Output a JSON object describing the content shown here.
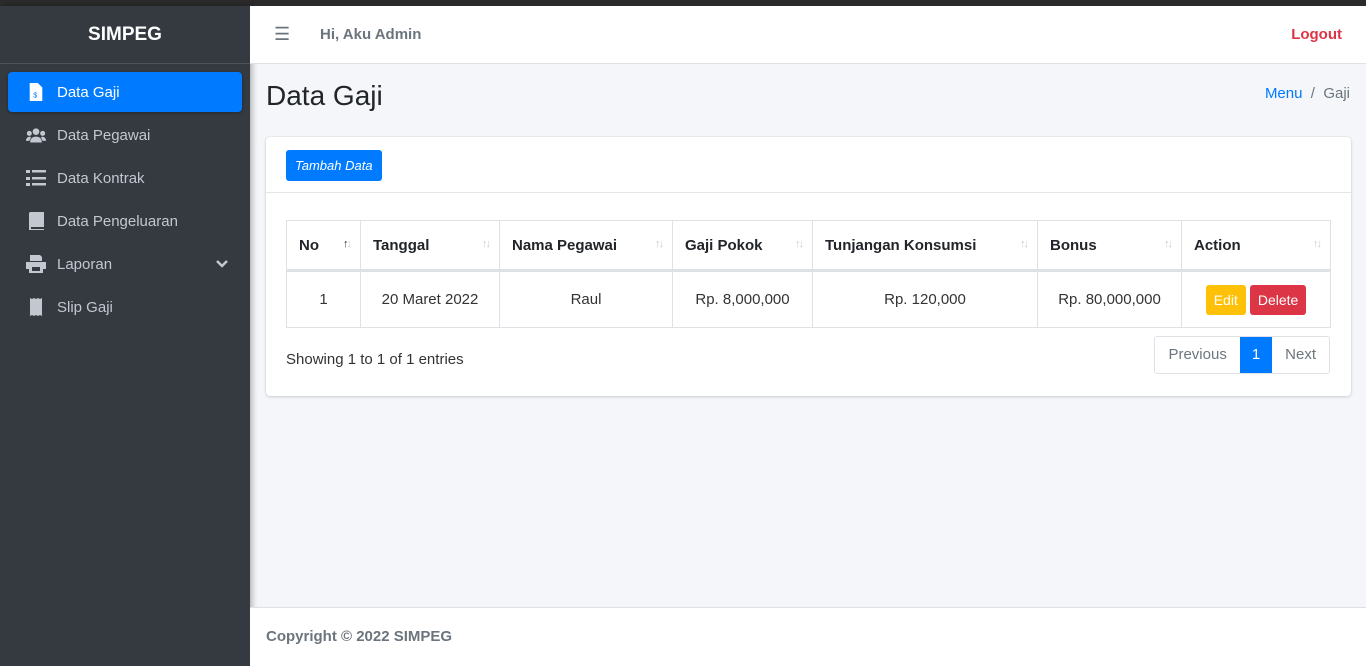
{
  "sidebar": {
    "brand": "SIMPEG",
    "items": [
      {
        "label": "Data Gaji",
        "icon": "file-invoice-dollar-icon",
        "active": true
      },
      {
        "label": "Data Pegawai",
        "icon": "users-icon"
      },
      {
        "label": "Data Kontrak",
        "icon": "tasks-icon"
      },
      {
        "label": "Data Pengeluaran",
        "icon": "book-icon"
      },
      {
        "label": "Laporan",
        "icon": "print-icon",
        "has_submenu": true
      },
      {
        "label": "Slip Gaji",
        "icon": "receipt-icon"
      }
    ]
  },
  "header": {
    "greeting": "Hi, Aku Admin",
    "logout": "Logout"
  },
  "page": {
    "title": "Data Gaji",
    "breadcrumb": [
      "Menu",
      "Gaji"
    ]
  },
  "card": {
    "add_button": "Tambah Data"
  },
  "table": {
    "columns": [
      "No",
      "Tanggal",
      "Nama Pegawai",
      "Gaji Pokok",
      "Tunjangan Konsumsi",
      "Bonus",
      "Action"
    ],
    "rows": [
      {
        "no": "1",
        "tanggal": "20 Maret 2022",
        "nama": "Raul",
        "gaji": "Rp. 8,000,000",
        "tunjangan": "Rp. 120,000",
        "bonus": "Rp. 80,000,000"
      }
    ],
    "edit": "Edit",
    "delete": "Delete"
  },
  "pagination": {
    "info": "Showing 1 to 1 of 1 entries",
    "previous": "Previous",
    "current": "1",
    "next": "Next"
  },
  "footer": {
    "text": "Copyright © 2022 SIMPEG"
  },
  "colors": {
    "primary": "#007bff",
    "warning": "#ffc107",
    "danger": "#dc3545",
    "sidebar": "#343a40"
  }
}
